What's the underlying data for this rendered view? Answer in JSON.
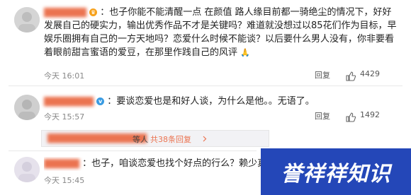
{
  "comments": [
    {
      "text": "：也子你能不能清醒一点 在颜值 路人缘目前都一骑绝尘的情况下，好好发展自己的硬实力，输出优秀作品不才是关键吗？难道就没想过以85花们作为目标，早娱乐圈拥有自己的一方天地吗？恋爱什么时候不能谈？以后要什么男人没有，你非要看着眼前甜言蜜语的爱豆，在那里作践自己的风评",
      "time": "今天 16:01",
      "reply": "回复",
      "likes": "4429"
    },
    {
      "text": "：要谈恋爱也是和好人谈，为什么是他。。无语了。",
      "time": "今天 15:57",
      "reply": "回复",
      "likes": "1492"
    },
    {
      "text": "：也子，咱谈恋爱也找个好点的行么？赖少真的不可",
      "time": "今天 15:45"
    }
  ],
  "reply_summary": {
    "deng": "等人",
    "total": "共38条回复"
  },
  "logo": {
    "text": "誉祥祥知识"
  },
  "colors": {
    "link": "#eb7350",
    "muted": "#888888",
    "panel": "#f2f2f5",
    "logo_bg": "#2447b8"
  }
}
